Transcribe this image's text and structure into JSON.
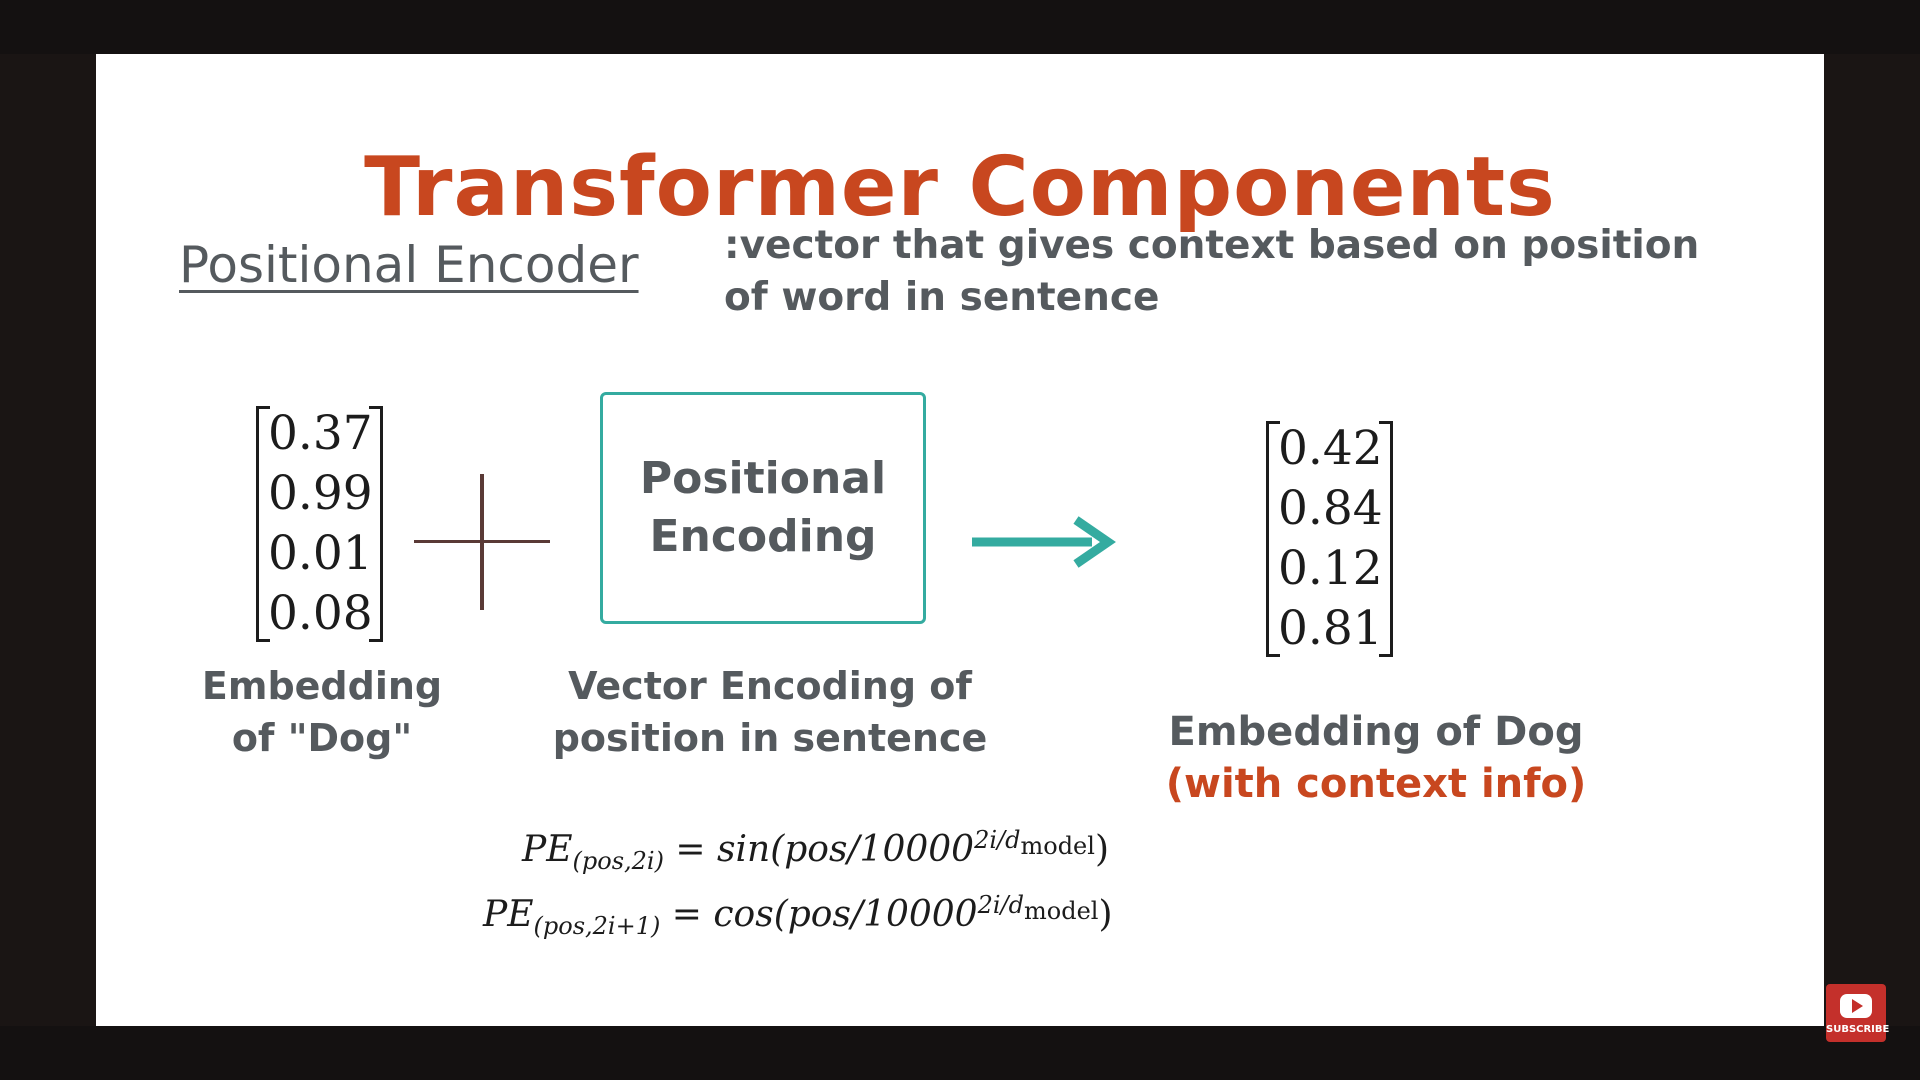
{
  "slide": {
    "title": "Transformer Components",
    "section_label": "Positional Encoder",
    "definition_line1": ":vector that gives context based on position",
    "definition_line2": "of word in sentence"
  },
  "input_embedding": {
    "values": [
      "0.37",
      "0.99",
      "0.01",
      "0.08"
    ],
    "caption_line1": "Embedding",
    "caption_line2": "of \"Dog\""
  },
  "positional_encoding": {
    "box_line1": "Positional",
    "box_line2": "Encoding",
    "caption_line1": "Vector Encoding of",
    "caption_line2": "position in sentence"
  },
  "output_embedding": {
    "values": [
      "0.42",
      "0.84",
      "0.12",
      "0.81"
    ],
    "caption_line1": "Embedding of Dog",
    "caption_line2": "(with context info)"
  },
  "formulas": {
    "f1_lhs": "PE",
    "f1_sub": "(pos,2i)",
    "f1_rhs": "= sin(pos/10000",
    "f1_exp": "2i/d",
    "f1_exp_sub": "model",
    "f1_close": ")",
    "f2_lhs": "PE",
    "f2_sub": "(pos,2i+1)",
    "f2_rhs": "= cos(pos/10000",
    "f2_exp": "2i/d",
    "f2_exp_sub": "model",
    "f2_close": ")"
  },
  "overlay": {
    "subscribe_label": "SUBSCRIBE"
  },
  "colors": {
    "title": "#c8471f",
    "text": "#555a5e",
    "teal": "#34aba0",
    "youtube": "#c4302b"
  },
  "icons": {
    "arrow": "arrow-right-icon",
    "plus": "plus-icon",
    "youtube": "youtube-play-icon"
  }
}
